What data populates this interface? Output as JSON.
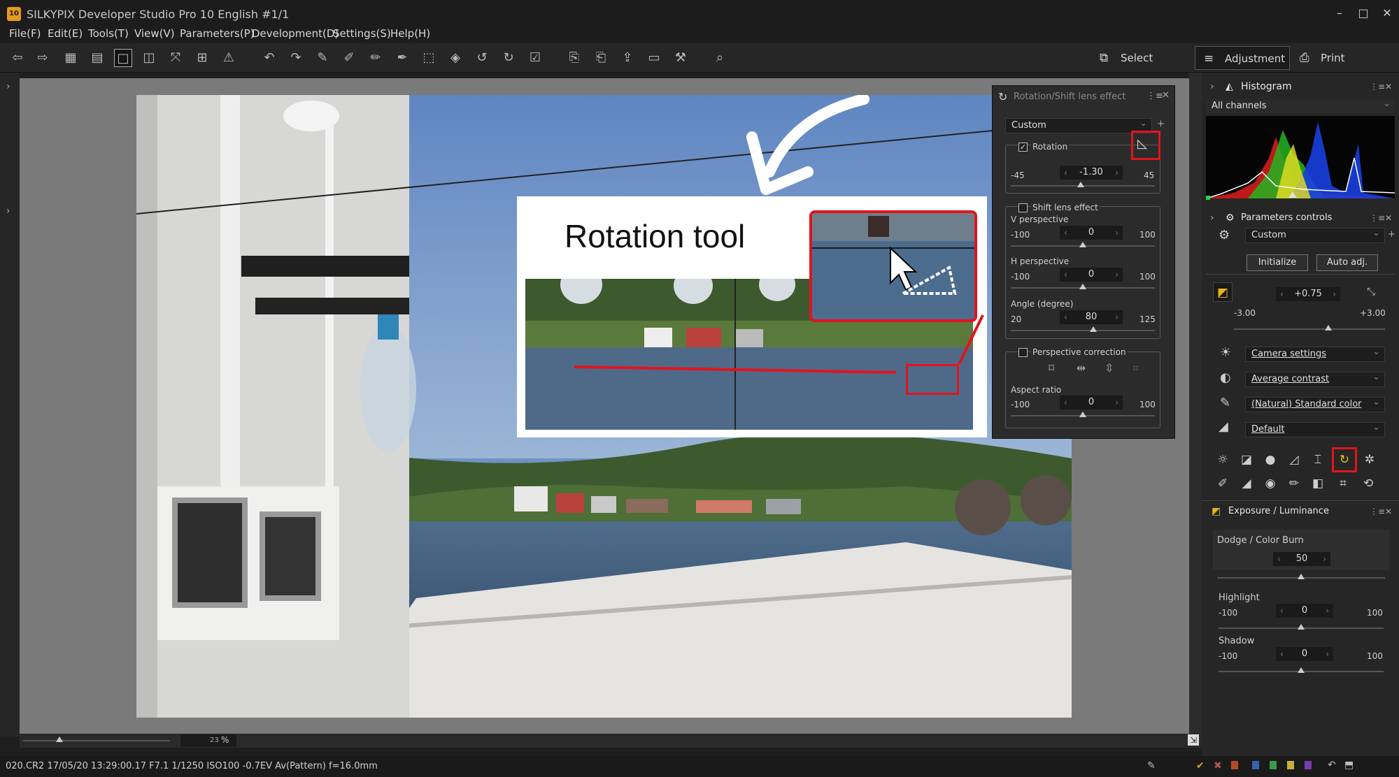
{
  "app": {
    "title": "SILKYPIX Developer Studio Pro 10 English   #1/1",
    "icon_text": "10"
  },
  "window_controls": {
    "minimize": "–",
    "maximize": "□",
    "close": "✕"
  },
  "menu": [
    "File(F)",
    "Edit(E)",
    "Tools(T)",
    "View(V)",
    "Parameters(P)",
    "Development(D)",
    "Settings(S)",
    "Help(H)"
  ],
  "modes": {
    "select": "Select",
    "adjustment": "Adjustment",
    "print": "Print"
  },
  "callout": {
    "title": "Rotation tool"
  },
  "rotation_panel": {
    "title": "Rotation/Shift lens effect",
    "preset": "Custom",
    "rotation": {
      "label": "Rotation",
      "min": "-45",
      "max": "45",
      "value": "-1.30",
      "checked": true,
      "level": 0.486
    },
    "shift_lens": {
      "label": "Shift lens effect",
      "checked": false
    },
    "v_perspective": {
      "label": "V perspective",
      "min": "-100",
      "max": "100",
      "value": "0",
      "level": 0.5
    },
    "h_perspective": {
      "label": "H perspective",
      "min": "-100",
      "max": "100",
      "value": "0",
      "level": 0.5
    },
    "angle": {
      "label": "Angle (degree)",
      "min": "20",
      "max": "125",
      "value": "80",
      "level": 0.571
    },
    "perspective_correction": {
      "label": "Perspective correction",
      "checked": false
    },
    "aspect_ratio": {
      "label": "Aspect ratio",
      "min": "-100",
      "max": "100",
      "value": "0",
      "level": 0.5
    }
  },
  "histogram": {
    "title": "Histogram",
    "channel": "All channels"
  },
  "parameters_controls": {
    "title": "Parameters controls",
    "preset": "Custom",
    "initialize": "Initialize",
    "auto_adj": "Auto adj.",
    "exposure": {
      "value": "+0.75",
      "min": "-3.00",
      "max": "+3.00",
      "level": 0.625
    },
    "white_balance": "Camera settings",
    "tone": "Average contrast",
    "color": "(Natural) Standard color",
    "sharpness": "Default"
  },
  "exposure_panel": {
    "title": "Exposure / Luminance",
    "dodge": {
      "label": "Dodge / Color Burn",
      "value": "50",
      "level": 0.5
    },
    "highlight": {
      "label": "Highlight",
      "min": "-100",
      "max": "100",
      "value": "0",
      "level": 0.5
    },
    "shadow": {
      "label": "Shadow",
      "min": "-100",
      "max": "100",
      "value": "0",
      "level": 0.5
    }
  },
  "zoom": {
    "value": "23",
    "unit": "%"
  },
  "status": {
    "text": "020.CR2 17/05/20 13:29:00.17 F7.1 1/1250 ISO100 -0.7EV Av(Pattern) f=16.0mm"
  }
}
